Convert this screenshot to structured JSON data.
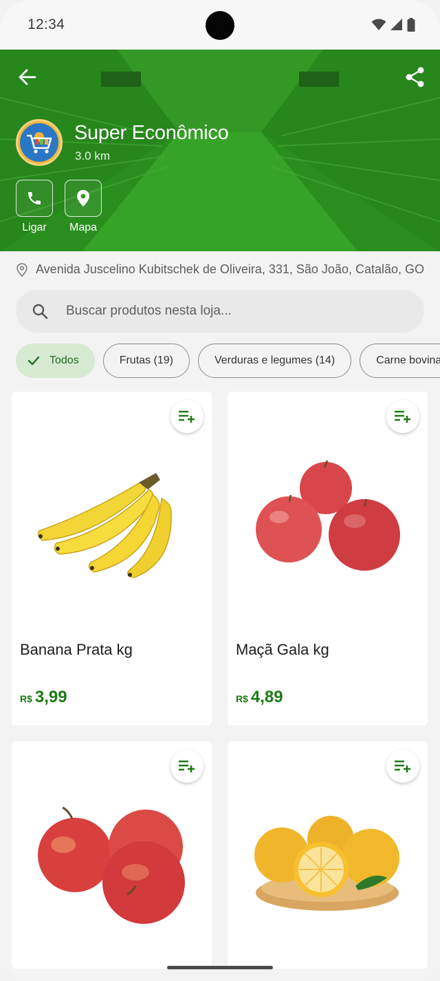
{
  "status_bar": {
    "time": "12:34"
  },
  "store": {
    "name": "Super Econômico",
    "distance": "3.0 km",
    "address": "Avenida Juscelino Kubitschek de Oliveira, 331, São João, Catalão, GO",
    "actions": [
      {
        "label": "Ligar",
        "icon": "phone-icon"
      },
      {
        "label": "Mapa",
        "icon": "map-pin-icon"
      }
    ]
  },
  "search": {
    "placeholder": "Buscar produtos nesta loja..."
  },
  "categories": [
    {
      "label": "Todos",
      "selected": true
    },
    {
      "label": "Frutas (19)",
      "selected": false
    },
    {
      "label": "Verduras e legumes (14)",
      "selected": false
    },
    {
      "label": "Carne bovina",
      "selected": false
    }
  ],
  "products": [
    {
      "name": "Banana Prata kg",
      "currency": "R$",
      "price": "3,99",
      "image": "banana"
    },
    {
      "name": "Maçã Gala kg",
      "currency": "R$",
      "price": "4,89",
      "image": "apples-red"
    },
    {
      "name": "",
      "currency": "",
      "price": "",
      "image": "apples-fuji"
    },
    {
      "name": "",
      "currency": "",
      "price": "",
      "image": "oranges"
    }
  ],
  "colors": {
    "brand_green": "#2f9a22",
    "price_green": "#1d7a14",
    "chip_active_bg": "#d6ead2"
  }
}
